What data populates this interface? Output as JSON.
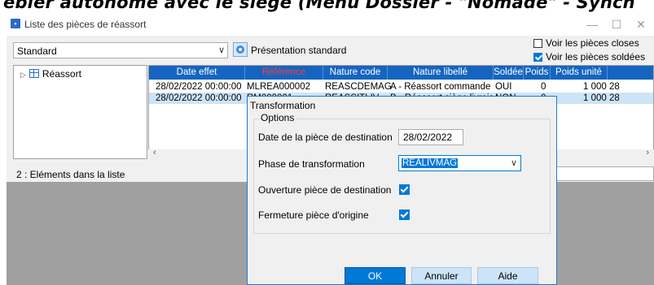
{
  "banner": {
    "text": "ebier autonome avec le siège (Menu Dossier - \"Nomade\" - Synch"
  },
  "window": {
    "title": "Liste des pièces de réassort",
    "controls": [
      "—",
      "☐",
      "✕"
    ]
  },
  "toolbar": {
    "view_value": "Standard",
    "presentation_label": "Présentation standard",
    "show_closed_label": "Voir les pièces closes",
    "show_closed_checked": false,
    "show_settled_label": "Voir les pièces soldées",
    "show_settled_checked": true
  },
  "tree": {
    "root_label": "Réassort"
  },
  "grid": {
    "columns": [
      "Date effet",
      "Référence",
      "Nature code",
      "Nature libellé",
      "Soldée",
      "Poids",
      "Poids unité"
    ],
    "rows": [
      [
        "28/02/2022 00:00:00",
        "MLREA000002",
        "REASCDEMAG",
        "A - Réassort commande ma...",
        "OUI",
        "0",
        "1 000",
        "28"
      ],
      [
        "28/02/2022 00:00:00",
        "RM000001",
        "REASSITLIV",
        "B - Réassort siège livraison ...",
        "NON",
        "0",
        "1 000",
        "28"
      ]
    ],
    "selected_row": 1,
    "reference_header_color": "#ff3b3b",
    "header_color": "#1565c0"
  },
  "status": {
    "count_label": "2 : Eléments dans la liste"
  },
  "dialog": {
    "title": "Transformation",
    "group_label": "Options",
    "date_label": "Date de la pièce de destination",
    "date_value": "28/02/2022",
    "phase_label": "Phase de transformation",
    "phase_value": "REALIVMAG",
    "open_dest_label": "Ouverture pièce de destination",
    "open_dest_checked": true,
    "close_origin_label": "Fermeture pièce d'origine",
    "close_origin_checked": true,
    "ok_label": "OK",
    "cancel_label": "Annuler",
    "help_label": "Aide",
    "accent_color": "#0078d7"
  }
}
